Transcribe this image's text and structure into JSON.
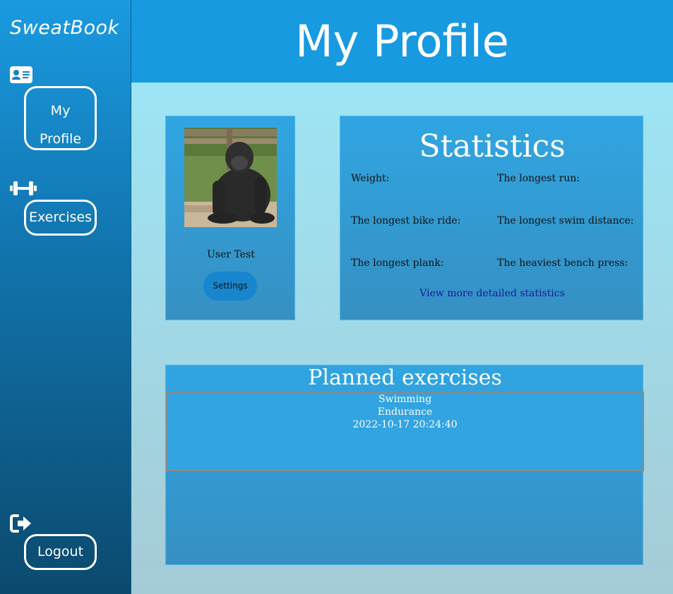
{
  "app": {
    "brand": "SweatBook"
  },
  "sidebar": {
    "items": [
      {
        "label_line1": "My",
        "label_line2": "Profile",
        "icon": "id-card-icon"
      },
      {
        "label": "Exercises",
        "icon": "dumbbell-icon"
      },
      {
        "label": "Logout",
        "icon": "logout-icon"
      }
    ]
  },
  "header": {
    "title": "My Profile"
  },
  "profile": {
    "user_name": "User Test",
    "settings_label": "Settings"
  },
  "stats": {
    "title": "Statistics",
    "labels": [
      "Weight:",
      "The longest run:",
      "The longest bike ride:",
      "The longest swim distance:",
      "The longest plank:",
      "The heaviest bench press:"
    ],
    "link": "View more detailed statistics"
  },
  "planned": {
    "title": "Planned exercises",
    "items": [
      {
        "name": "Swimming",
        "type": "Endurance",
        "datetime": "2022-10-17 20:24:40"
      }
    ]
  },
  "colors": {
    "header": "#189ae0",
    "card": "#30a5e2",
    "link": "#1a1aa0"
  }
}
